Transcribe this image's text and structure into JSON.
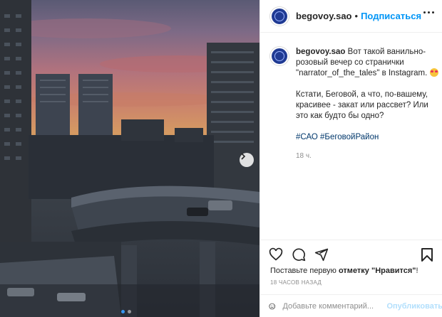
{
  "post": {
    "username": "begovoy.sao",
    "separator": "•",
    "follow_label": "Подписаться",
    "caption_user": "begovoy.sao",
    "caption_line1": "Вот такой ванильно-розовый вечер со странички \"narrator_of_the_tales\" в Instagram.",
    "caption_line2": "Кстати, Беговой, а что, по-вашему, красивее - закат или рассвет? Или это как будто бы одно?",
    "hashtags": "#САО #БеговойРайон",
    "time_ago": "18 ч.",
    "likes_prefix": "Поставьте первую",
    "likes_middle": "отметку \"Нравится\"",
    "likes_suffix": "!",
    "timestamp": "18 ЧАСОВ НАЗАД",
    "comment_placeholder": "Добавьте комментарий...",
    "publish_label": "Опубликовать"
  },
  "carousel": {
    "slide_count": 2,
    "active_index": 0
  },
  "colors": {
    "accent": "#0095f6",
    "publish_disabled": "#b2dffc",
    "hashtag": "#00376b"
  }
}
